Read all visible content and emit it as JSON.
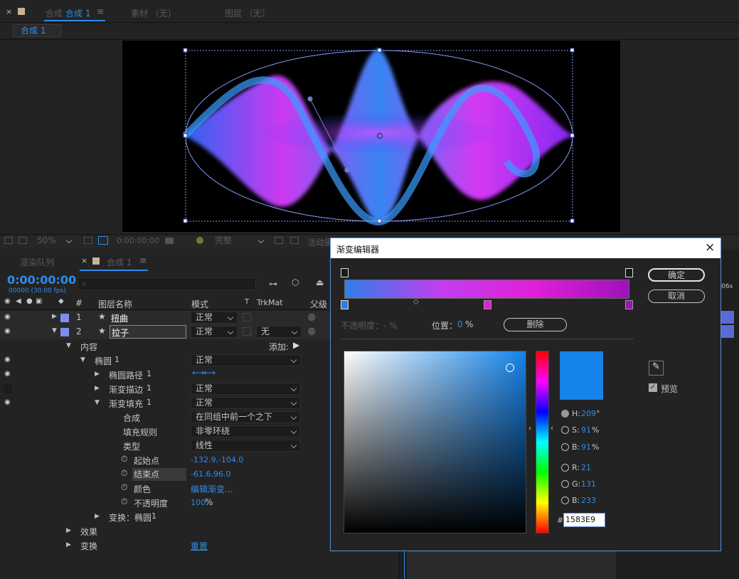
{
  "tabs": {
    "comp_tab": "合成",
    "comp_name": "合成 1",
    "footage": "素材 （无）",
    "layer": "图层 （无）",
    "sub_tab": "合成 1"
  },
  "viewer_bar": {
    "zoom": "50%",
    "time": "0:00:00:00",
    "quality": "完整",
    "active": "活动摄"
  },
  "timeline": {
    "render_queue": "渲染队列",
    "comp_tab": "合成 1",
    "timecode": "0:00:00:00",
    "fps": "00000 (30.00 fps)",
    "col_num": "#",
    "col_name": "图层名称",
    "col_mode": "模式",
    "col_t": "T",
    "col_trkmat": "TrkMat",
    "col_parent": "父级"
  },
  "layers": [
    {
      "index": "1",
      "name": "扭曲",
      "mode": "正常",
      "color": "#7b8ff0"
    },
    {
      "index": "2",
      "name": "拉子",
      "mode": "正常",
      "trkmat": "无",
      "color": "#7b8ff0"
    }
  ],
  "props": {
    "content": "内容",
    "add": "添加:",
    "ellipse": "椭圆",
    "ellipse_n": "1",
    "ellipse_mode": "正常",
    "ellipse_path": "椭圆路径",
    "ellipse_path_n": "1",
    "grad_stroke": "渐变描边",
    "grad_stroke_n": "1",
    "grad_stroke_mode": "正常",
    "grad_fill": "渐变填充",
    "grad_fill_n": "1",
    "grad_fill_mode": "正常",
    "composite": "合成",
    "composite_val": "在同组中前一个之下",
    "fill_rule": "填充规则",
    "fill_rule_val": "非零环绕",
    "type": "类型",
    "type_val": "线性",
    "start": "起始点",
    "start_val": "-132.9,-104.0",
    "end": "结束点",
    "end_val": "-61.6,96.0",
    "color": "颜色",
    "color_val": "编辑渐变...",
    "opacity": "不透明度",
    "opacity_val": "100",
    "opacity_unit": "%",
    "transform_ellipse": "变换：椭圆",
    "transform_ellipse_n": "1",
    "effects": "效果",
    "transform": "变换",
    "reset": "重置"
  },
  "dialog": {
    "title": "渐变编辑器",
    "ok": "确定",
    "cancel": "取消",
    "opacity_label": "不透明度：- %",
    "position_label": "位置：",
    "position_val": "0",
    "position_unit": "%",
    "delete": "删除",
    "h_label": "H:",
    "h_val": "209",
    "h_unit": "°",
    "s_label": "S:",
    "s_val": "91",
    "s_unit": "%",
    "b_label": "B:",
    "b_val": "91",
    "b_unit": "%",
    "r_label": "R:",
    "r_val": "21",
    "g_label": "G:",
    "g_val": "131",
    "bb_label": "B:",
    "bb_val": "233",
    "hash": "#",
    "hex": "1583E9",
    "preview": "预览",
    "gradient_colors": [
      "#2f7fe8",
      "#c23ef0",
      "#e21ed8",
      "#9d13b8"
    ],
    "picked_color": "#1583e9"
  },
  "right_edge": {
    "label": "06s"
  }
}
